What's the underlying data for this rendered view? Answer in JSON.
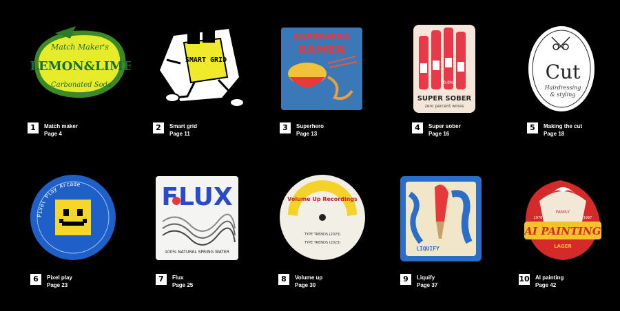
{
  "items": [
    {
      "num": "1",
      "title": "Match maker",
      "page": "Page 4",
      "art_text": {
        "top": "Match Maker's",
        "main": "LEMON&LIME",
        "bottom": "Carbonated Soda"
      }
    },
    {
      "num": "2",
      "title": "Smart grid",
      "page": "Page 11",
      "art_text": {
        "main": "SMART GRID"
      }
    },
    {
      "num": "3",
      "title": "Superhero",
      "page": "Page 13",
      "art_text": {
        "line1": "SUPERHERO",
        "line2": "RAMEN"
      }
    },
    {
      "num": "4",
      "title": "Super sober",
      "page": "Page 16",
      "art_text": {
        "main": "SUPER SOBER",
        "sub": "zero percent wines",
        "pct": "0.0%"
      }
    },
    {
      "num": "5",
      "title": "Making the cut",
      "page": "Page 18",
      "art_text": {
        "main": "Cut",
        "sub1": "Hairdressing",
        "sub2": "& styling"
      }
    },
    {
      "num": "6",
      "title": "Pixel play",
      "page": "Page 23",
      "art_text": {
        "ring": "Pixel Play Arcade"
      }
    },
    {
      "num": "7",
      "title": "Flux",
      "page": "Page 25",
      "art_text": {
        "main": "FLUX",
        "sub": "100% NATURAL SPRING WATER"
      }
    },
    {
      "num": "8",
      "title": "Volume up",
      "page": "Page 30",
      "art_text": {
        "main": "Volume Up Recordings",
        "t1": "TYPE TRENDS (2023)",
        "t2": "TYPE TRENDS (2023)"
      }
    },
    {
      "num": "9",
      "title": "Liquify",
      "page": "Page 37",
      "art_text": {
        "main": "LIQUIFY"
      }
    },
    {
      "num": "10",
      "title": "AI painting",
      "page": "Page 42",
      "art_text": {
        "top": "FAMILY",
        "main": "AI PAINTING",
        "sub": "LAGER",
        "y1": "1976",
        "y2": "1967"
      }
    }
  ],
  "colors": {
    "background": "#000000",
    "caption_text": "#ffffff",
    "number_box_bg": "#ffffff",
    "number_box_text": "#000000"
  }
}
